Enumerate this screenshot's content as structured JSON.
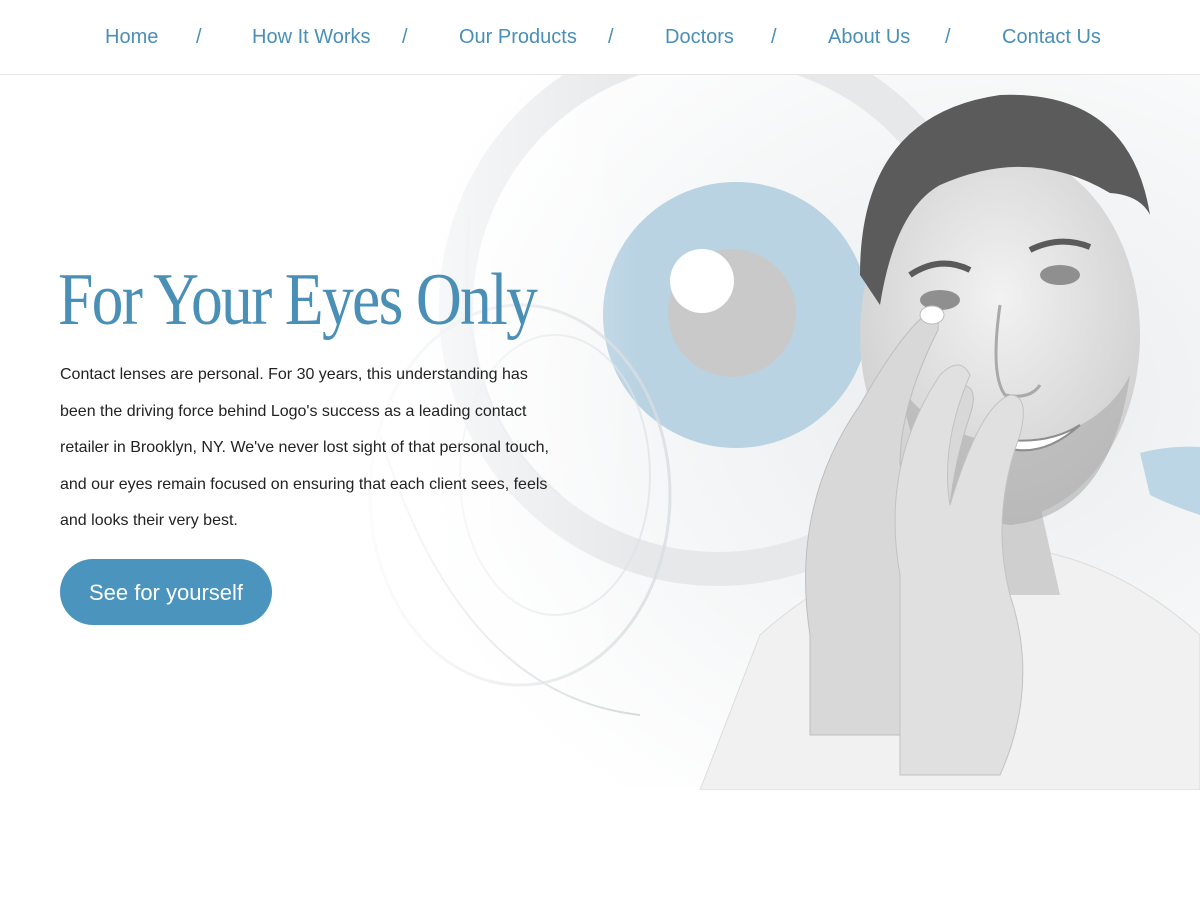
{
  "nav": {
    "items": [
      {
        "label": "Home"
      },
      {
        "label": "How It Works"
      },
      {
        "label": "Our Products"
      },
      {
        "label": "Doctors"
      },
      {
        "label": "About Us"
      },
      {
        "label": "Contact Us"
      }
    ],
    "separator": "/"
  },
  "hero": {
    "title": "For Your Eyes Only",
    "body": "Contact lenses are personal. For 30 years, this understanding has been the driving force behind Logo's success as a leading contact retailer in Brooklyn, NY. We've never lost sight of that personal touch, and our eyes remain focused on ensuring that each client sees, feels and looks their very best.",
    "cta_label": "See for yourself"
  },
  "colors": {
    "accent": "#4a8fb6",
    "button": "#4a94bd",
    "text": "#222222"
  }
}
